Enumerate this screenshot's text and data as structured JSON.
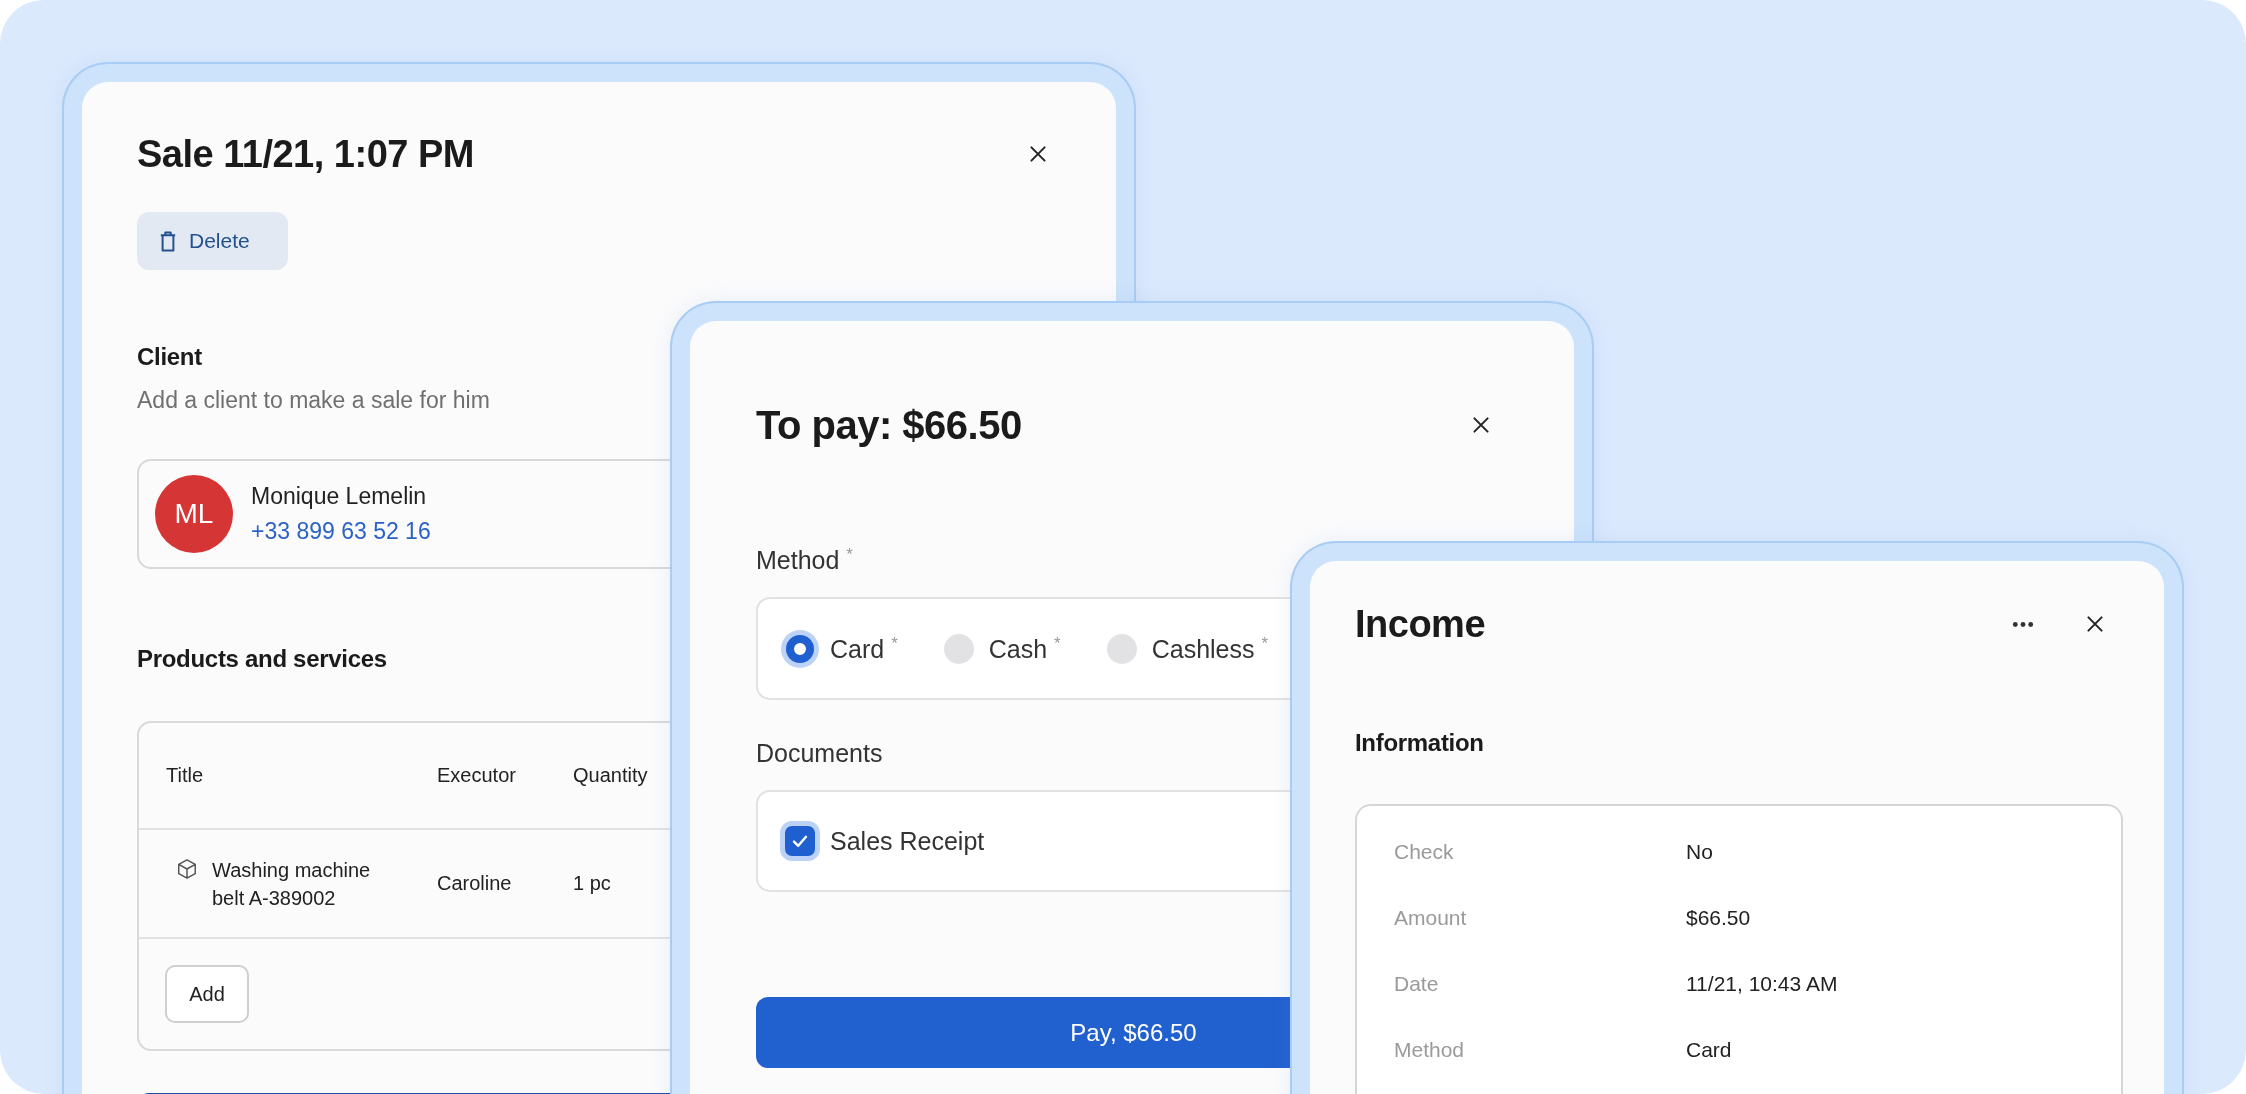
{
  "sale_dialog": {
    "title": "Sale 11/21, 1:07 PM",
    "delete_button": "Delete",
    "client": {
      "heading": "Client",
      "hint": "Add a client to make a sale for him",
      "initials": "ML",
      "name": "Monique Lemelin",
      "phone": "+33 899 63 52 16"
    },
    "products": {
      "heading": "Products and services",
      "columns": [
        "Title",
        "Executor",
        "Quantity"
      ],
      "rows": [
        {
          "title": "Washing machine belt A-389002",
          "executor": "Caroline",
          "quantity": "1 pc"
        }
      ],
      "add_button": "Add"
    }
  },
  "payment_dialog": {
    "title": "To pay: $66.50",
    "method": {
      "label": "Method",
      "mark": "*",
      "options": [
        {
          "label": "Card",
          "mark": "*",
          "selected": true
        },
        {
          "label": "Cash",
          "mark": "*",
          "selected": false
        },
        {
          "label": "Cashless",
          "mark": "*",
          "selected": false
        }
      ]
    },
    "documents": {
      "label": "Documents",
      "items": [
        {
          "label": "Sales Receipt",
          "checked": true
        }
      ]
    },
    "pay_button": "Pay, $66.50"
  },
  "income_dialog": {
    "title": "Income",
    "section": "Information",
    "details": [
      {
        "label": "Check",
        "value": "No"
      },
      {
        "label": "Amount",
        "value": "$66.50"
      },
      {
        "label": "Date",
        "value": "11/21, 10:43 AM"
      },
      {
        "label": "Method",
        "value": "Card"
      }
    ]
  }
}
